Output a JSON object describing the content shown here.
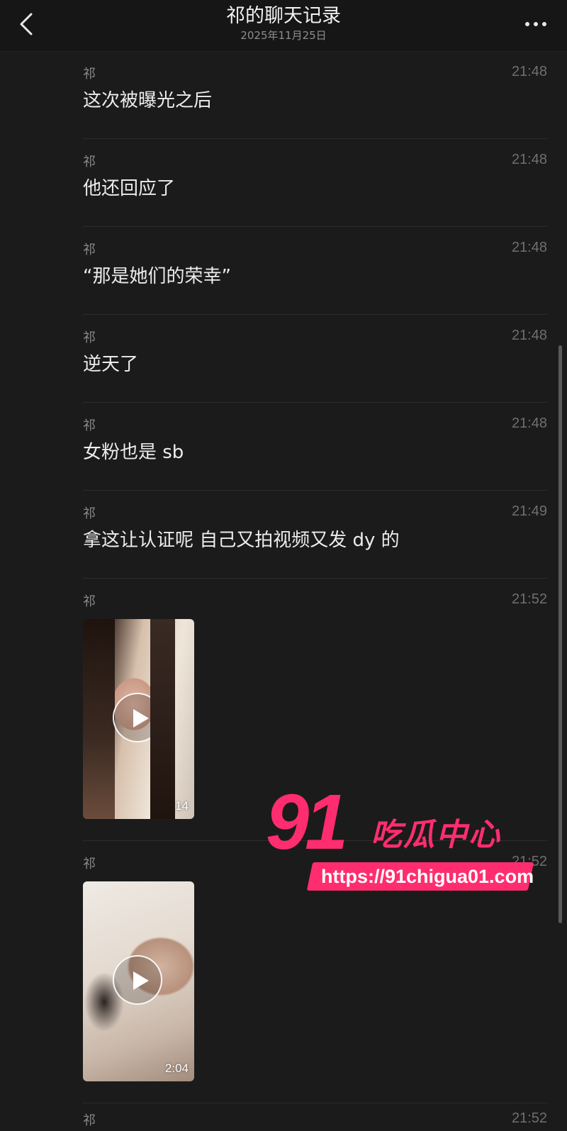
{
  "header": {
    "title": "祁的聊天记录",
    "subtitle": "2025年11月25日",
    "back_icon": "chevron-left-icon",
    "more_icon": "more-horizontal-icon"
  },
  "messages": [
    {
      "sender": "祁",
      "time": "21:48",
      "text": "这次被曝光之后"
    },
    {
      "sender": "祁",
      "time": "21:48",
      "text": "他还回应了"
    },
    {
      "sender": "祁",
      "time": "21:48",
      "text": "“那是她们的荣幸”"
    },
    {
      "sender": "祁",
      "time": "21:48",
      "text": "逆天了"
    },
    {
      "sender": "祁",
      "time": "21:48",
      "text": "女粉也是 sb"
    },
    {
      "sender": "祁",
      "time": "21:49",
      "text": "拿这让认证呢 自己又拍视频又发 dy 的"
    },
    {
      "sender": "祁",
      "time": "21:52",
      "video_duration": "0:14"
    },
    {
      "sender": "祁",
      "time": "21:52",
      "video_duration": "2:04"
    },
    {
      "sender": "祁",
      "time": "21:52"
    }
  ],
  "watermark": {
    "number": "91",
    "brand": "吃瓜中心",
    "url": "https://91chigua01.com"
  },
  "colors": {
    "background": "#1b1b1b",
    "header": "#161616",
    "watermark_accent": "#ff2d6f"
  }
}
